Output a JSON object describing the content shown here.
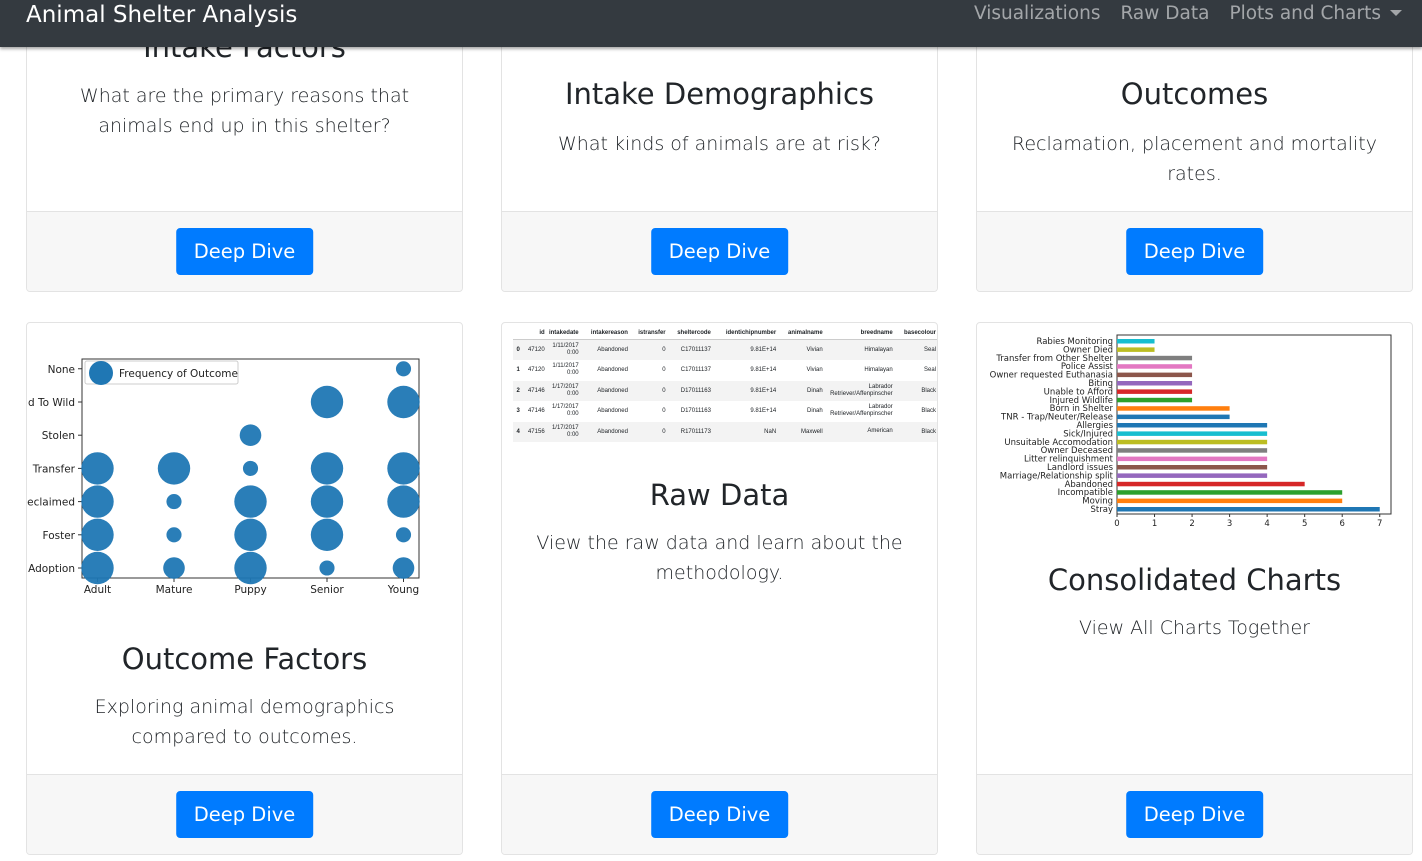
{
  "navbar": {
    "brand": "Animal Shelter Analysis",
    "links": [
      "Visualizations",
      "Raw Data",
      "Plots and Charts"
    ]
  },
  "cards": [
    {
      "title": "Intake Factors",
      "text": "What are the primary reasons that animals end up in this shelter?",
      "button": "Deep Dive"
    },
    {
      "title": "Intake Demographics",
      "text": "What kinds of animals are at risk?",
      "button": "Deep Dive"
    },
    {
      "title": "Outcomes",
      "text": "Reclamation, placement and mortality rates.",
      "button": "Deep Dive"
    },
    {
      "title": "Outcome Factors",
      "text": "Exploring animal demographics compared to outcomes.",
      "button": "Deep Dive"
    },
    {
      "title": "Raw Data",
      "text": "View the raw data and learn about the methodology.",
      "button": "Deep Dive"
    },
    {
      "title": "Consolidated Charts",
      "text": "View All Charts Together",
      "button": "Deep Dive"
    }
  ],
  "raw_table": {
    "columns": [
      "",
      "id",
      "intakedate",
      "intakereason",
      "istransfer",
      "sheltercode",
      "identichipnumber",
      "animalname",
      "breedname",
      "basecolour"
    ],
    "rows": [
      [
        "0",
        "47120",
        "1/11/2017 0:00",
        "Abandoned",
        "0",
        "C17011137",
        "9.81E+14",
        "Vivian",
        "Himalayan",
        "Seal"
      ],
      [
        "1",
        "47120",
        "1/11/2017 0:00",
        "Abandoned",
        "0",
        "C17011137",
        "9.81E+14",
        "Vivian",
        "Himalayan",
        "Seal"
      ],
      [
        "2",
        "47146",
        "1/17/2017 0:00",
        "Abandoned",
        "0",
        "D17011163",
        "9.81E+14",
        "Dinah",
        "Labrador Retriever/Affenpinscher",
        "Black"
      ],
      [
        "3",
        "47146",
        "1/17/2017 0:00",
        "Abandoned",
        "0",
        "D17011163",
        "9.81E+14",
        "Dinah",
        "Labrador Retriever/Affenpinscher",
        "Black"
      ],
      [
        "4",
        "47156",
        "1/17/2017 0:00",
        "Abandoned",
        "0",
        "R17011173",
        "NaN",
        "Maxwell",
        "American",
        "Black"
      ]
    ]
  },
  "chart_data": [
    {
      "type": "scatter",
      "legend": "Frequency of Outcome",
      "x_categories": [
        "Adult",
        "Mature",
        "Puppy",
        "Senior",
        "Young"
      ],
      "y_categories": [
        "Adoption",
        "Foster",
        "Reclaimed",
        "Transfer",
        "Stolen",
        "Returned To Wild",
        "None"
      ],
      "visible_y_tick_labels": [
        "Adoption",
        "Foster",
        "eclaimed",
        "Transfer",
        "Stolen",
        "d To Wild",
        "None"
      ],
      "points": [
        {
          "x": "Adult",
          "y": "Adoption",
          "size": 3.0
        },
        {
          "x": "Adult",
          "y": "Foster",
          "size": 3.0
        },
        {
          "x": "Adult",
          "y": "Reclaimed",
          "size": 3.0
        },
        {
          "x": "Adult",
          "y": "Transfer",
          "size": 3.0
        },
        {
          "x": "Mature",
          "y": "Adoption",
          "size": 2.0
        },
        {
          "x": "Mature",
          "y": "Foster",
          "size": 1.4
        },
        {
          "x": "Mature",
          "y": "Reclaimed",
          "size": 1.4
        },
        {
          "x": "Mature",
          "y": "Transfer",
          "size": 3.0
        },
        {
          "x": "Puppy",
          "y": "Adoption",
          "size": 3.0
        },
        {
          "x": "Puppy",
          "y": "Foster",
          "size": 3.0
        },
        {
          "x": "Puppy",
          "y": "Reclaimed",
          "size": 3.0
        },
        {
          "x": "Puppy",
          "y": "Transfer",
          "size": 1.4
        },
        {
          "x": "Puppy",
          "y": "Stolen",
          "size": 2.0
        },
        {
          "x": "Senior",
          "y": "Adoption",
          "size": 1.4
        },
        {
          "x": "Senior",
          "y": "Foster",
          "size": 3.0
        },
        {
          "x": "Senior",
          "y": "Reclaimed",
          "size": 3.0
        },
        {
          "x": "Senior",
          "y": "Transfer",
          "size": 3.0
        },
        {
          "x": "Senior",
          "y": "Returned To Wild",
          "size": 3.0
        },
        {
          "x": "Young",
          "y": "Adoption",
          "size": 2.0
        },
        {
          "x": "Young",
          "y": "Foster",
          "size": 1.4
        },
        {
          "x": "Young",
          "y": "Reclaimed",
          "size": 3.0
        },
        {
          "x": "Young",
          "y": "Transfer",
          "size": 3.0
        },
        {
          "x": "Young",
          "y": "Returned To Wild",
          "size": 3.0
        },
        {
          "x": "Young",
          "y": "None",
          "size": 1.4
        }
      ],
      "color": "#1f77b4"
    },
    {
      "type": "bar",
      "orientation": "horizontal",
      "categories": [
        "Stray",
        "Moving",
        "Incompatible",
        "Abandoned",
        "Marriage/Relationship split",
        "Landlord issues",
        "Litter relinquishment",
        "Owner Deceased",
        "Unsuitable Accomodation",
        "Sick/Injured",
        "Allergies",
        "TNR - Trap/Neuter/Release",
        "Born in Shelter",
        "Injured Wildlife",
        "Unable to Afford",
        "Biting",
        "Owner requested Euthanasia",
        "Police Assist",
        "Transfer from Other Shelter",
        "Owner Died",
        "Rabies Monitoring"
      ],
      "values": [
        7,
        6,
        6,
        5,
        4,
        4,
        4,
        4,
        4,
        4,
        4,
        3,
        3,
        2,
        2,
        2,
        2,
        2,
        2,
        1,
        1
      ],
      "colors": [
        "#1f77b4",
        "#ff7f0e",
        "#2ca02c",
        "#d62728",
        "#9467bd",
        "#8c564b",
        "#e377c2",
        "#7f7f7f",
        "#bcbd22",
        "#17becf",
        "#1f77b4",
        "#1f77b4",
        "#ff7f0e",
        "#2ca02c",
        "#d62728",
        "#9467bd",
        "#8c564b",
        "#e377c2",
        "#7f7f7f",
        "#bcbd22",
        "#17becf"
      ],
      "xticks": [
        "0",
        "1",
        "2",
        "3",
        "4",
        "5",
        "6",
        "7"
      ],
      "xlim": [
        0,
        7.3
      ]
    }
  ]
}
